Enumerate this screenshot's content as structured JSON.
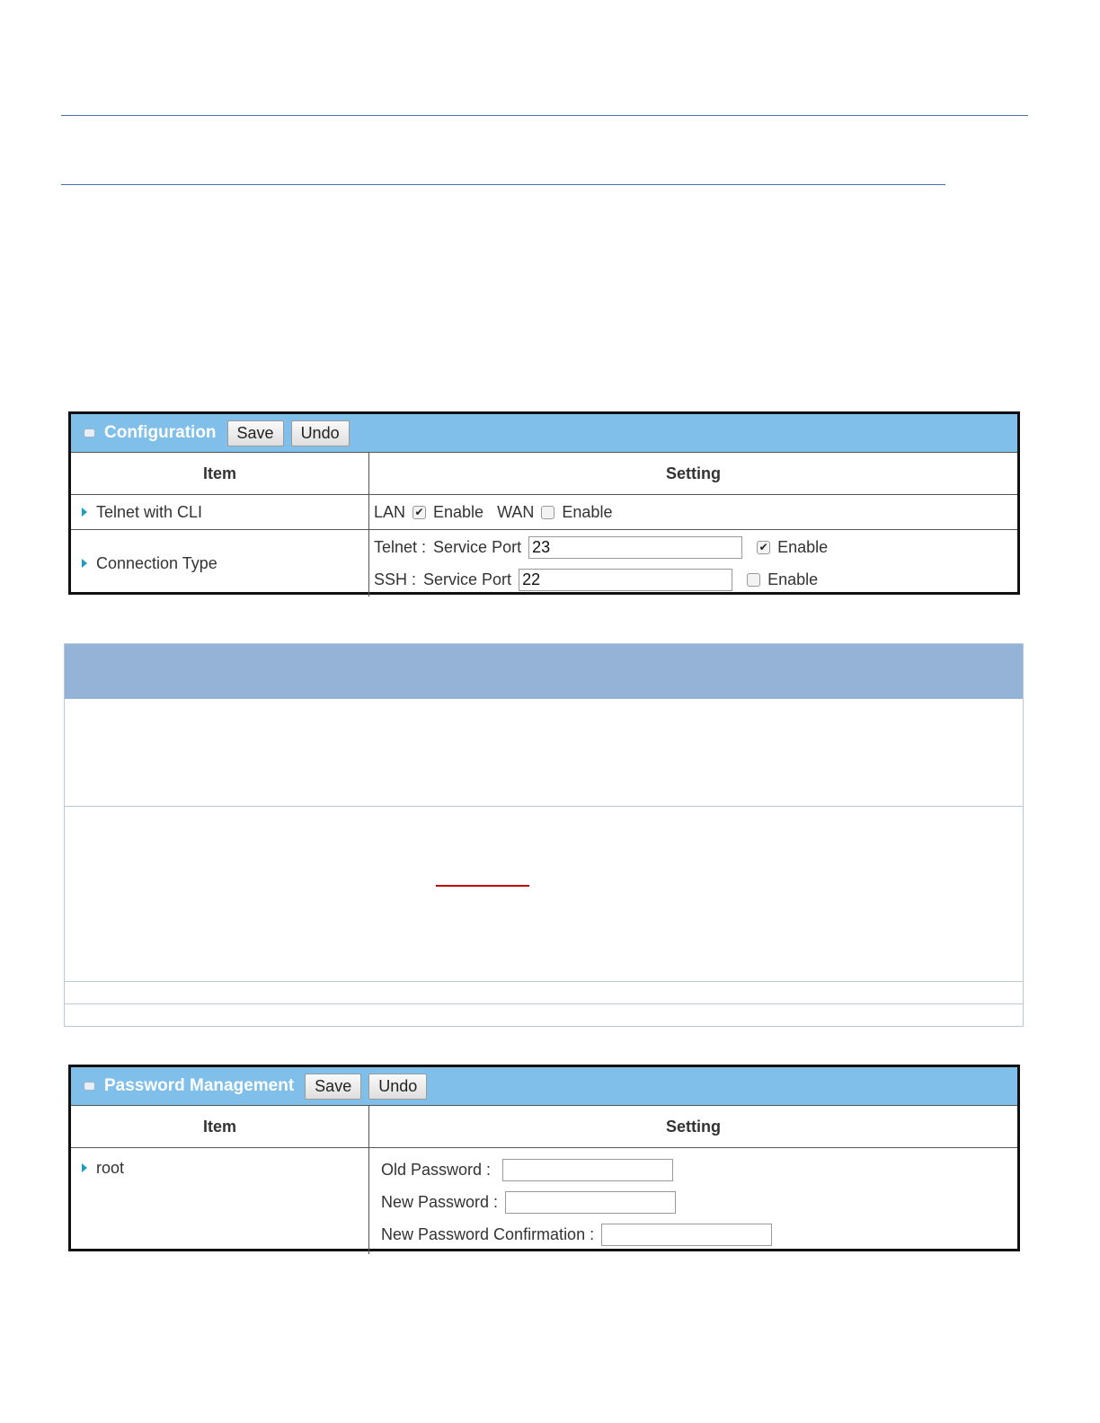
{
  "config_panel": {
    "title": "Configuration",
    "save_label": "Save",
    "undo_label": "Undo",
    "col_item": "Item",
    "col_setting": "Setting",
    "telnet_cli": {
      "label": "Telnet with CLI",
      "lan_label": "LAN",
      "lan_enable_label": "Enable",
      "lan_checked": true,
      "wan_label": "WAN",
      "wan_enable_label": "Enable",
      "wan_checked": false
    },
    "connection_type": {
      "label": "Connection Type",
      "telnet_label": "Telnet :",
      "telnet_port_label": "Service Port",
      "telnet_port_value": "23",
      "telnet_enable_label": "Enable",
      "telnet_checked": true,
      "ssh_label": "SSH :",
      "ssh_port_label": "Service Port",
      "ssh_port_value": "22",
      "ssh_enable_label": "Enable",
      "ssh_checked": false
    }
  },
  "password_panel": {
    "title": "Password Management",
    "save_label": "Save",
    "undo_label": "Undo",
    "col_item": "Item",
    "col_setting": "Setting",
    "user": "root",
    "old_password_label": "Old Password :",
    "new_password_label": "New Password :",
    "confirm_label": "New Password Confirmation :"
  },
  "colors": {
    "panel_header": "#7fbfea",
    "note_header": "#95b3d7",
    "arrow": "#1a9fc0"
  }
}
